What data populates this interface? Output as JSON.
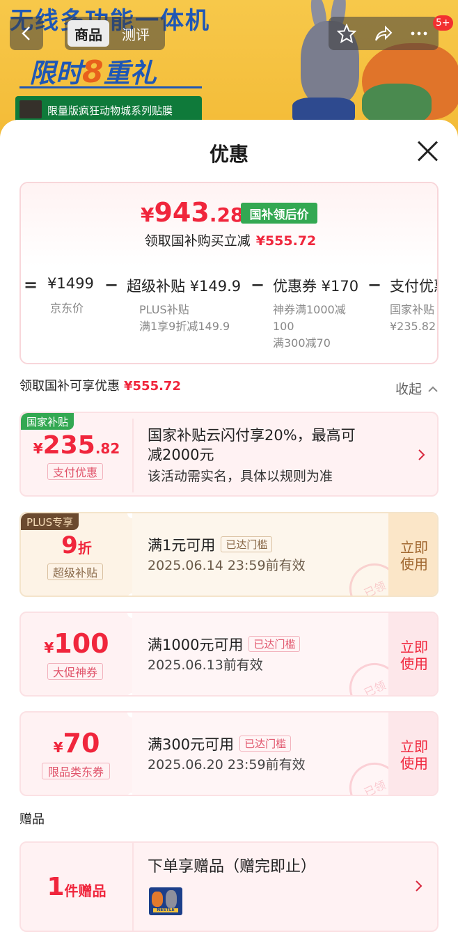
{
  "banner": {
    "headline": "无线多功能一体机",
    "promo_text_before": "限时",
    "promo_eight": "8",
    "promo_text_after": "重礼",
    "film_strip": "限量版疯狂动物城系列贴膜"
  },
  "nav": {
    "back_icon": "chevron-left-icon",
    "tabs": [
      {
        "label": "商品",
        "active": true
      },
      {
        "label": "测评",
        "active": false
      }
    ],
    "icons": [
      "star-icon",
      "share-icon",
      "more-icon"
    ],
    "message_count": "5+"
  },
  "sheet": {
    "title": "优惠",
    "close_icon": "close-icon"
  },
  "summary": {
    "currency": "¥",
    "final_int": "943",
    "final_dec": ".28",
    "final_tag": "国补领后价",
    "reduce_text": "领取国补购买立减",
    "reduce_amount": "¥555.72",
    "formula": [
      {
        "op": "=",
        "main": "¥1499",
        "subs": [
          "京东价"
        ]
      },
      {
        "op": "−",
        "main": "超级补贴 ¥149.9",
        "subs": [
          "PLUS补贴",
          "满1享9折减149.9"
        ]
      },
      {
        "op": "−",
        "main": "优惠券 ¥170",
        "subs": [
          "神券满1000减",
          "100",
          "满300减70"
        ]
      },
      {
        "op": "−",
        "main": "支付优惠",
        "subs": [
          "国家补贴",
          "¥235.82"
        ]
      }
    ]
  },
  "section": {
    "label": "领取国补可享优惠",
    "amount": "¥555.72",
    "collapse_label": "收起",
    "collapse_icon": "chevron-up-icon"
  },
  "coupons": [
    {
      "corner_tag": "国家补贴",
      "yen": "¥",
      "amount_int": "235",
      "amount_dec": ".82",
      "sublabel": "支付优惠",
      "title_line1": "国家补贴云闪付享20%，最高可",
      "title_line2": "减2000元",
      "desc": "该活动需实名，具体以规则为准",
      "arrow_icon": "chevron-right-icon"
    },
    {
      "corner_tag": "PLUS专享",
      "amount_int": "9",
      "amount_unit": "折",
      "sublabel": "超级补贴",
      "title": "满1元可用",
      "reach_tag": "已达门槛",
      "desc": "2025.06.14 23:59前有效",
      "use_label_1": "立即",
      "use_label_2": "使用",
      "stamp": "已领"
    },
    {
      "yen": "¥",
      "amount_int": "100",
      "sublabel": "大促神券",
      "title": "满1000元可用",
      "reach_tag": "已达门槛",
      "desc": "2025.06.13前有效",
      "use_label_1": "立即",
      "use_label_2": "使用",
      "stamp": "已领"
    },
    {
      "yen": "¥",
      "amount_int": "70",
      "sublabel": "限品类东券",
      "title": "满300元可用",
      "reach_tag": "已达门槛",
      "desc": "2025.06.20 23:59前有效",
      "use_label_1": "立即",
      "use_label_2": "使用",
      "stamp": "已领"
    }
  ],
  "gift": {
    "section_label": "赠品",
    "count": "1",
    "unit": "件赠品",
    "title": "下单享赠品（赠完即止）",
    "thumb_text": "NESTLE",
    "arrow_icon": "chevron-right-icon"
  },
  "colors": {
    "accent_red": "#f0263c",
    "gov_green": "#33a852",
    "plus_brown": "#6b4a2f"
  }
}
